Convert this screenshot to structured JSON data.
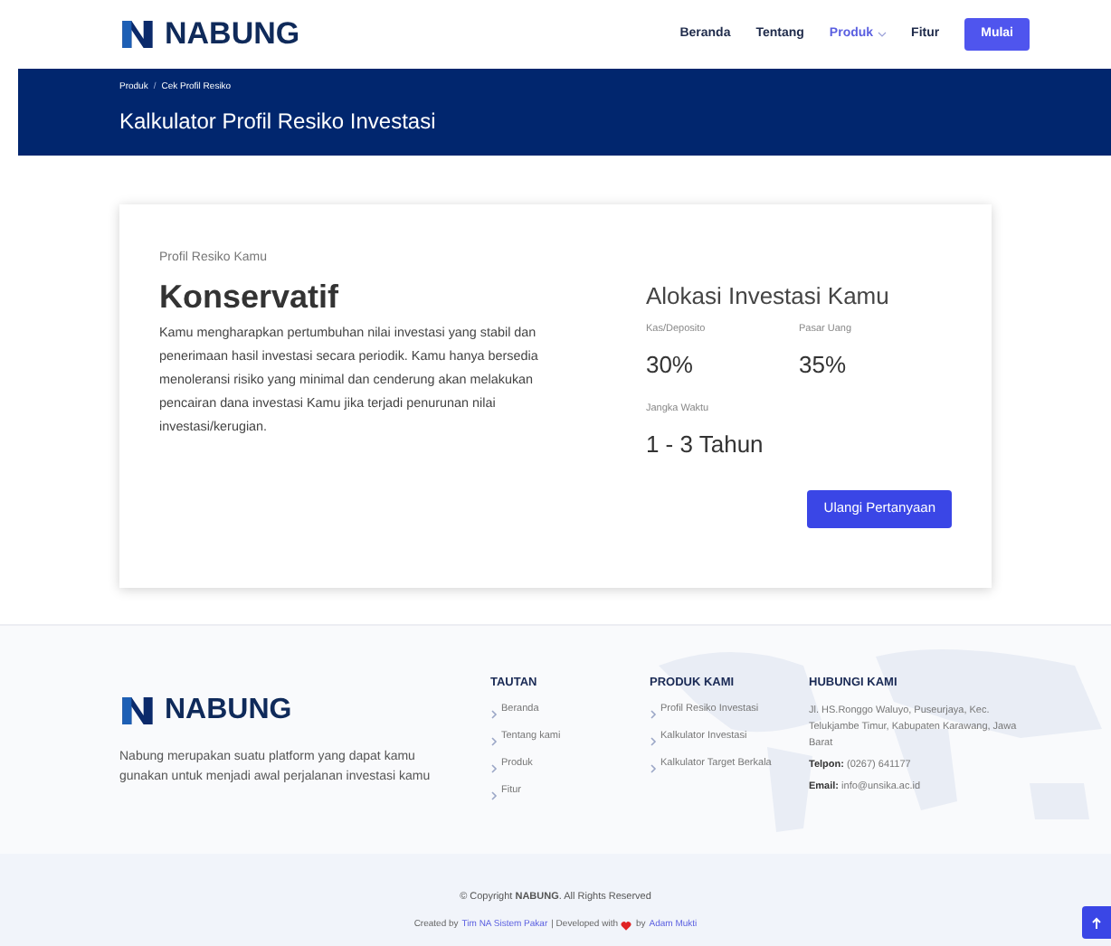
{
  "navbar": {
    "brand": "NABUNG",
    "items": [
      {
        "label": "Beranda",
        "selected": false,
        "dropdown": false
      },
      {
        "label": "Tentang",
        "selected": false,
        "dropdown": false
      },
      {
        "label": "Produk",
        "selected": true,
        "dropdown": true
      },
      {
        "label": "Fitur",
        "selected": false,
        "dropdown": false
      }
    ],
    "cta": "Mulai"
  },
  "banner": {
    "breadcrumb": [
      "Produk",
      "Cek Profil Resiko"
    ],
    "separator": "/",
    "title": "Kalkulator Profil Resiko Investasi"
  },
  "result": {
    "caption": "Profil Resiko Kamu",
    "profile": "Konservatif",
    "description": "Kamu mengharapkan pertumbuhan nilai investasi yang stabil dan penerimaan hasil investasi secara periodik. Kamu hanya bersedia menoleransi risiko yang minimal dan cenderung akan melakukan pencairan dana investasi Kamu jika terjadi penurunan nilai investasi/kerugian.",
    "allocation_title": "Alokasi Investasi Kamu",
    "allocations": [
      {
        "label": "Kas/Deposito",
        "value": "30%"
      },
      {
        "label": "Pasar Uang",
        "value": "35%"
      }
    ],
    "term": {
      "label": "Jangka Waktu",
      "value": "1 - 3 Tahun"
    },
    "button": "Ulangi Pertanyaan"
  },
  "footer": {
    "brand": "NABUNG",
    "about": "Nabung merupakan suatu platform yang dapat kamu gunakan untuk menjadi awal perjalanan investasi kamu",
    "columns": [
      {
        "heading": "TAUTAN",
        "links": [
          "Beranda",
          "Tentang kami",
          "Produk",
          "Fitur"
        ]
      },
      {
        "heading": "PRODUK KAMI",
        "links": [
          "Profil Resiko Investasi",
          "Kalkulator Investasi",
          "Kalkulator Target Berkala"
        ]
      }
    ],
    "contact": {
      "heading": "HUBUNGI KAMI",
      "lines": [
        "Jl. HS.Ronggo Waluyo, Puseurjaya, Kec. Telukjambe Timur, Kabupaten Karawang, Jawa Barat",
        "**Telpon:** (0267) 641177",
        "**Email:** info@unsika.ac.id"
      ]
    },
    "copyright": "© Copyright **NABUNG**. All Rights Reserved",
    "credit": {
      "before": "Created by",
      "team": "Tim NA Sistem Pakar",
      "middle": "| Developed with",
      "after": "by",
      "author": "Adam Mukti"
    }
  }
}
